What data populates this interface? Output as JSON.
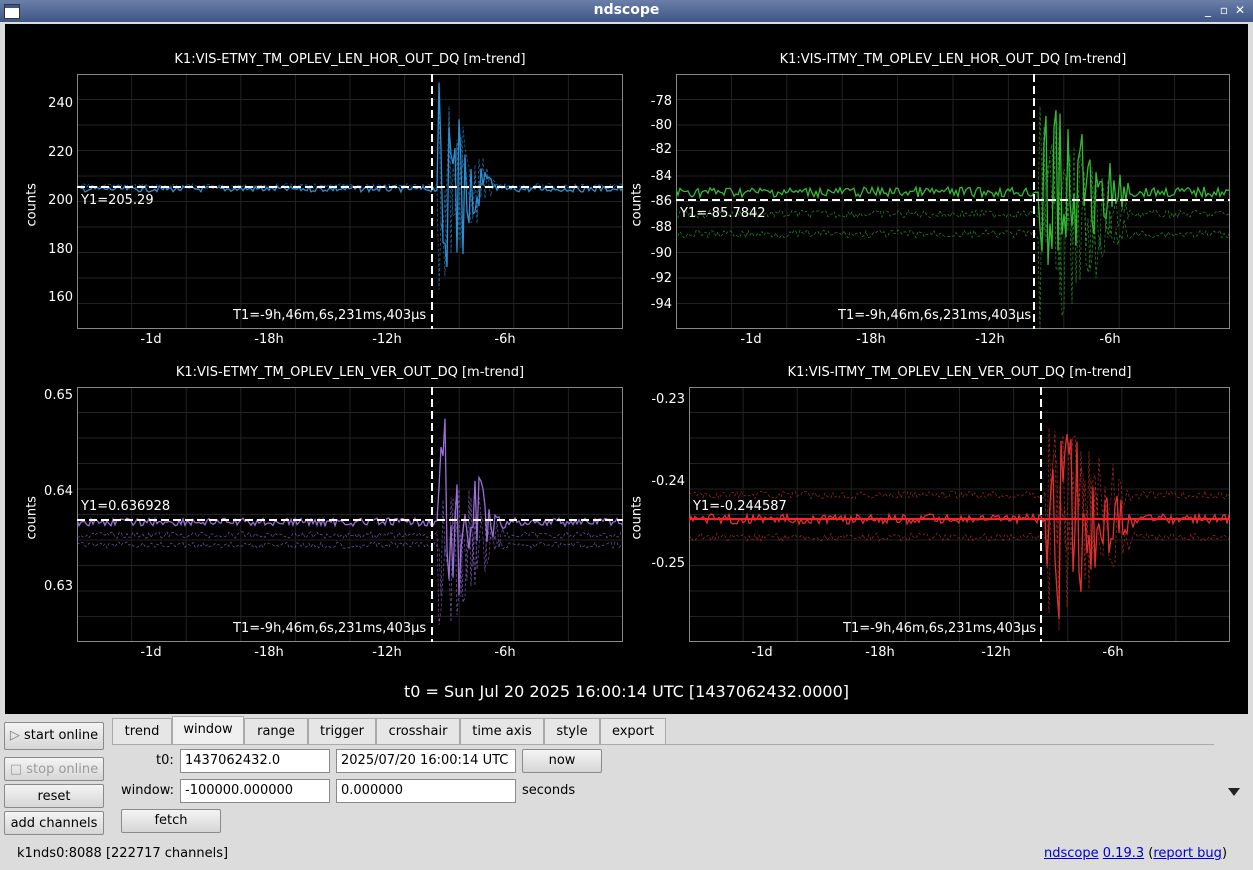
{
  "window": {
    "title": "ndscope",
    "minimize": "_",
    "maximize": "▫",
    "close": "✕"
  },
  "plots": [
    {
      "title": "K1:VIS-ETMY_TM_OPLEV_LEN_HOR_OUT_DQ [m-trend]",
      "ylabel": "counts",
      "color": "#2e8fd4",
      "yticks": [
        "240",
        "220",
        "200",
        "180",
        "160"
      ],
      "xticks": [
        "-1d",
        "-18h",
        "-12h",
        "-6h"
      ],
      "y1": "Y1=205.29",
      "t1": "T1=-9h,46m,6s,231ms,403µs"
    },
    {
      "title": "K1:VIS-ITMY_TM_OPLEV_LEN_HOR_OUT_DQ [m-trend]",
      "ylabel": "counts",
      "color": "#33bb33",
      "yticks": [
        "-78",
        "-80",
        "-82",
        "-84",
        "-86",
        "-88",
        "-90",
        "-92",
        "-94"
      ],
      "xticks": [
        "-1d",
        "-18h",
        "-12h",
        "-6h"
      ],
      "y1": "Y1=-85.7842",
      "t1": "T1=-9h,46m,6s,231ms,403µs"
    },
    {
      "title": "K1:VIS-ETMY_TM_OPLEV_LEN_VER_OUT_DQ [m-trend]",
      "ylabel": "counts",
      "color": "#9a6fd8",
      "yticks": [
        "0.65",
        "0.64",
        "0.63"
      ],
      "xticks": [
        "-1d",
        "-18h",
        "-12h",
        "-6h"
      ],
      "y1": "Y1=0.636928",
      "t1": "T1=-9h,46m,6s,231ms,403µs"
    },
    {
      "title": "K1:VIS-ITMY_TM_OPLEV_LEN_VER_OUT_DQ [m-trend]",
      "ylabel": "counts",
      "color": "#e03030",
      "yticks": [
        "-0.23",
        "-0.24",
        "-0.25"
      ],
      "xticks": [
        "-1d",
        "-18h",
        "-12h",
        "-6h"
      ],
      "y1": "Y1=-0.244587",
      "t1": "T1=-9h,46m,6s,231ms,403µs"
    }
  ],
  "t0_label": "t0 = Sun Jul 20 2025 16:00:14 UTC [1437062432.0000]",
  "side_buttons": {
    "start": "start online",
    "stop": "stop online",
    "reset": "reset",
    "add": "add channels"
  },
  "tabs": [
    "trend",
    "window",
    "range",
    "trigger",
    "crosshair",
    "time axis",
    "style",
    "export"
  ],
  "active_tab": "window",
  "window_tab": {
    "t0_label": "t0:",
    "t0_gps": "1437062432.0",
    "t0_utc": "2025/07/20 16:00:14 UTC",
    "now_label": "now",
    "window_label": "window:",
    "window_start": "-100000.000000",
    "window_end": "0.000000",
    "seconds_label": "seconds",
    "fetch_label": "fetch"
  },
  "status": {
    "server": "k1nds0:8088",
    "channels": "[222717 channels]",
    "app_link": "ndscope",
    "version_link": "0.19.3",
    "open_paren": "(",
    "report_link": "report bug",
    "close_paren": ")"
  }
}
